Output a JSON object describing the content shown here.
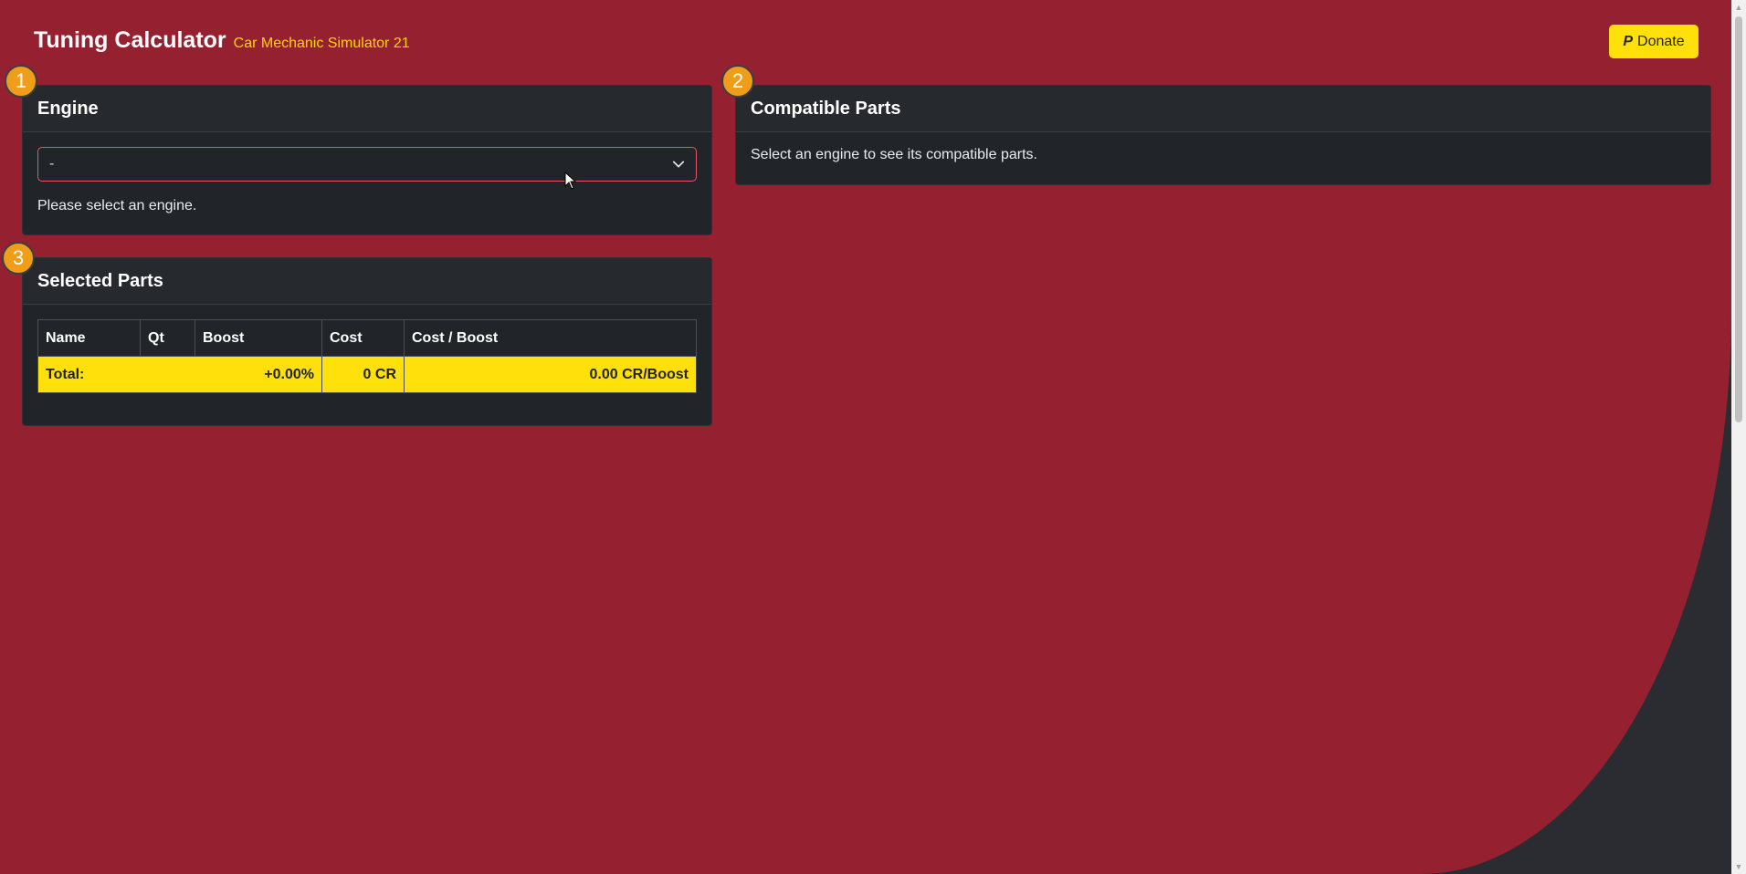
{
  "header": {
    "title": "Tuning Calculator",
    "subtitle": "Car Mechanic Simulator 21",
    "donate_label": "Donate",
    "donate_icon": "paypal-icon"
  },
  "colors": {
    "background_red": "#952030",
    "card_bg": "#212529",
    "accent_yellow": "#ffe00a",
    "badge_orange": "#f09d1a"
  },
  "engine_card": {
    "step": "1",
    "title": "Engine",
    "select_value": "-",
    "hint": "Please select an engine."
  },
  "compatible_card": {
    "step": "2",
    "title": "Compatible Parts",
    "message": "Select an engine to see its compatible parts."
  },
  "selected_card": {
    "step": "3",
    "title": "Selected Parts",
    "columns": [
      "Name",
      "Qt",
      "Boost",
      "Cost",
      "Cost / Boost"
    ],
    "total": {
      "label": "Total:",
      "boost": "+0.00%",
      "cost": "0 CR",
      "cost_per_boost": "0.00 CR/Boost"
    }
  }
}
